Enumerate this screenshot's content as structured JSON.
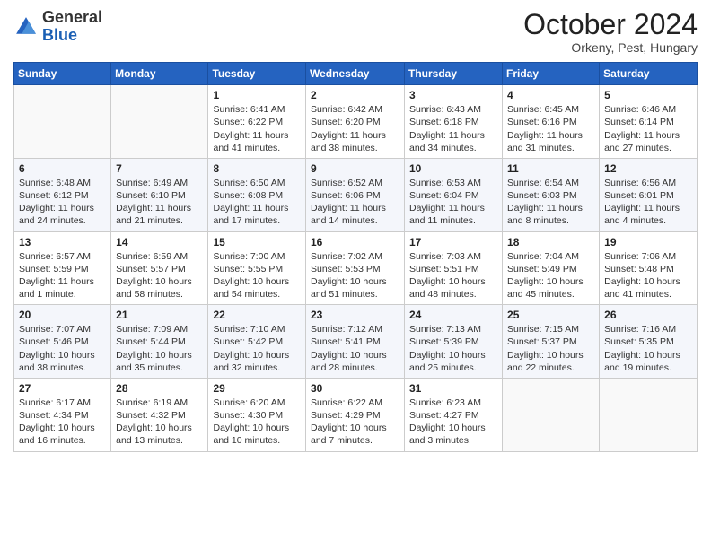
{
  "header": {
    "logo": {
      "general": "General",
      "blue": "Blue"
    },
    "title": "October 2024",
    "subtitle": "Orkeny, Pest, Hungary"
  },
  "calendar": {
    "days_of_week": [
      "Sunday",
      "Monday",
      "Tuesday",
      "Wednesday",
      "Thursday",
      "Friday",
      "Saturday"
    ],
    "weeks": [
      [
        {
          "day": "",
          "info": ""
        },
        {
          "day": "",
          "info": ""
        },
        {
          "day": "1",
          "info": "Sunrise: 6:41 AM\nSunset: 6:22 PM\nDaylight: 11 hours and 41 minutes."
        },
        {
          "day": "2",
          "info": "Sunrise: 6:42 AM\nSunset: 6:20 PM\nDaylight: 11 hours and 38 minutes."
        },
        {
          "day": "3",
          "info": "Sunrise: 6:43 AM\nSunset: 6:18 PM\nDaylight: 11 hours and 34 minutes."
        },
        {
          "day": "4",
          "info": "Sunrise: 6:45 AM\nSunset: 6:16 PM\nDaylight: 11 hours and 31 minutes."
        },
        {
          "day": "5",
          "info": "Sunrise: 6:46 AM\nSunset: 6:14 PM\nDaylight: 11 hours and 27 minutes."
        }
      ],
      [
        {
          "day": "6",
          "info": "Sunrise: 6:48 AM\nSunset: 6:12 PM\nDaylight: 11 hours and 24 minutes."
        },
        {
          "day": "7",
          "info": "Sunrise: 6:49 AM\nSunset: 6:10 PM\nDaylight: 11 hours and 21 minutes."
        },
        {
          "day": "8",
          "info": "Sunrise: 6:50 AM\nSunset: 6:08 PM\nDaylight: 11 hours and 17 minutes."
        },
        {
          "day": "9",
          "info": "Sunrise: 6:52 AM\nSunset: 6:06 PM\nDaylight: 11 hours and 14 minutes."
        },
        {
          "day": "10",
          "info": "Sunrise: 6:53 AM\nSunset: 6:04 PM\nDaylight: 11 hours and 11 minutes."
        },
        {
          "day": "11",
          "info": "Sunrise: 6:54 AM\nSunset: 6:03 PM\nDaylight: 11 hours and 8 minutes."
        },
        {
          "day": "12",
          "info": "Sunrise: 6:56 AM\nSunset: 6:01 PM\nDaylight: 11 hours and 4 minutes."
        }
      ],
      [
        {
          "day": "13",
          "info": "Sunrise: 6:57 AM\nSunset: 5:59 PM\nDaylight: 11 hours and 1 minute."
        },
        {
          "day": "14",
          "info": "Sunrise: 6:59 AM\nSunset: 5:57 PM\nDaylight: 10 hours and 58 minutes."
        },
        {
          "day": "15",
          "info": "Sunrise: 7:00 AM\nSunset: 5:55 PM\nDaylight: 10 hours and 54 minutes."
        },
        {
          "day": "16",
          "info": "Sunrise: 7:02 AM\nSunset: 5:53 PM\nDaylight: 10 hours and 51 minutes."
        },
        {
          "day": "17",
          "info": "Sunrise: 7:03 AM\nSunset: 5:51 PM\nDaylight: 10 hours and 48 minutes."
        },
        {
          "day": "18",
          "info": "Sunrise: 7:04 AM\nSunset: 5:49 PM\nDaylight: 10 hours and 45 minutes."
        },
        {
          "day": "19",
          "info": "Sunrise: 7:06 AM\nSunset: 5:48 PM\nDaylight: 10 hours and 41 minutes."
        }
      ],
      [
        {
          "day": "20",
          "info": "Sunrise: 7:07 AM\nSunset: 5:46 PM\nDaylight: 10 hours and 38 minutes."
        },
        {
          "day": "21",
          "info": "Sunrise: 7:09 AM\nSunset: 5:44 PM\nDaylight: 10 hours and 35 minutes."
        },
        {
          "day": "22",
          "info": "Sunrise: 7:10 AM\nSunset: 5:42 PM\nDaylight: 10 hours and 32 minutes."
        },
        {
          "day": "23",
          "info": "Sunrise: 7:12 AM\nSunset: 5:41 PM\nDaylight: 10 hours and 28 minutes."
        },
        {
          "day": "24",
          "info": "Sunrise: 7:13 AM\nSunset: 5:39 PM\nDaylight: 10 hours and 25 minutes."
        },
        {
          "day": "25",
          "info": "Sunrise: 7:15 AM\nSunset: 5:37 PM\nDaylight: 10 hours and 22 minutes."
        },
        {
          "day": "26",
          "info": "Sunrise: 7:16 AM\nSunset: 5:35 PM\nDaylight: 10 hours and 19 minutes."
        }
      ],
      [
        {
          "day": "27",
          "info": "Sunrise: 6:17 AM\nSunset: 4:34 PM\nDaylight: 10 hours and 16 minutes."
        },
        {
          "day": "28",
          "info": "Sunrise: 6:19 AM\nSunset: 4:32 PM\nDaylight: 10 hours and 13 minutes."
        },
        {
          "day": "29",
          "info": "Sunrise: 6:20 AM\nSunset: 4:30 PM\nDaylight: 10 hours and 10 minutes."
        },
        {
          "day": "30",
          "info": "Sunrise: 6:22 AM\nSunset: 4:29 PM\nDaylight: 10 hours and 7 minutes."
        },
        {
          "day": "31",
          "info": "Sunrise: 6:23 AM\nSunset: 4:27 PM\nDaylight: 10 hours and 3 minutes."
        },
        {
          "day": "",
          "info": ""
        },
        {
          "day": "",
          "info": ""
        }
      ]
    ]
  }
}
